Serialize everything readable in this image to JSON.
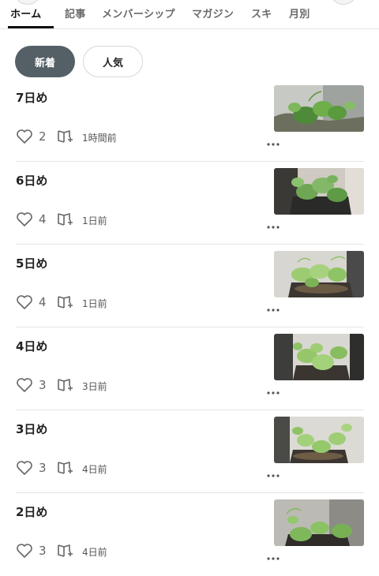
{
  "tabs": [
    {
      "label": "ホーム",
      "active": true
    },
    {
      "label": "記事"
    },
    {
      "label": "メンバーシップ"
    },
    {
      "label": "マガジン"
    },
    {
      "label": "スキ"
    },
    {
      "label": "月別"
    }
  ],
  "filters": {
    "new_label": "新着",
    "popular_label": "人気",
    "selected": "新着"
  },
  "articles": [
    {
      "title": "7日め",
      "likes": "2",
      "time": "1時間前"
    },
    {
      "title": "6日め",
      "likes": "4",
      "time": "1日前"
    },
    {
      "title": "5日め",
      "likes": "4",
      "time": "1日前"
    },
    {
      "title": "4日め",
      "likes": "3",
      "time": "3日前"
    },
    {
      "title": "3日め",
      "likes": "3",
      "time": "4日前"
    },
    {
      "title": "2日め",
      "likes": "3",
      "time": "4日前"
    }
  ],
  "colors": {
    "accent_chip": "#556066",
    "text_primary": "#222222",
    "text_muted": "#666666",
    "divider": "#e4e4e4"
  },
  "icons": {
    "like": "heart-icon",
    "magazine": "magazine-add-icon",
    "more": "more-dots-icon"
  }
}
